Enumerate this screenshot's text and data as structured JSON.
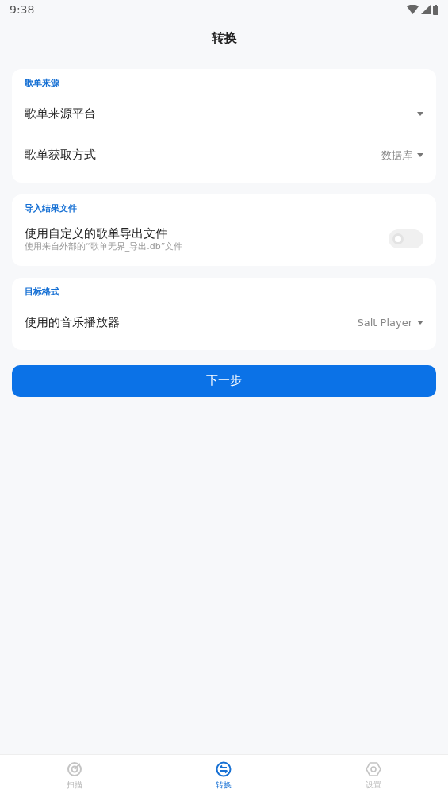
{
  "status_bar": {
    "time": "9:38"
  },
  "title": "转换",
  "sections": [
    {
      "header": "歌单来源",
      "items": [
        {
          "kind": "select",
          "label": "歌单来源平台"
        },
        {
          "kind": "select",
          "label": "歌单获取方式",
          "value": "数据库"
        }
      ]
    },
    {
      "header": "导入结果文件",
      "items": [
        {
          "kind": "toggle",
          "label": "使用自定义的歌单导出文件",
          "description": "使用来自外部的“歌单无界_导出.db”文件",
          "on": false,
          "disabled": true
        }
      ]
    },
    {
      "header": "目标格式",
      "items": [
        {
          "kind": "select",
          "label": "使用的音乐播放器",
          "value": "Salt Player"
        }
      ]
    }
  ],
  "next_button": "下一步",
  "nav": [
    {
      "kind": "scan",
      "label": "扫描",
      "selected": false
    },
    {
      "kind": "convert",
      "label": "转换",
      "selected": true
    },
    {
      "kind": "settings",
      "label": "设置",
      "selected": false
    }
  ]
}
